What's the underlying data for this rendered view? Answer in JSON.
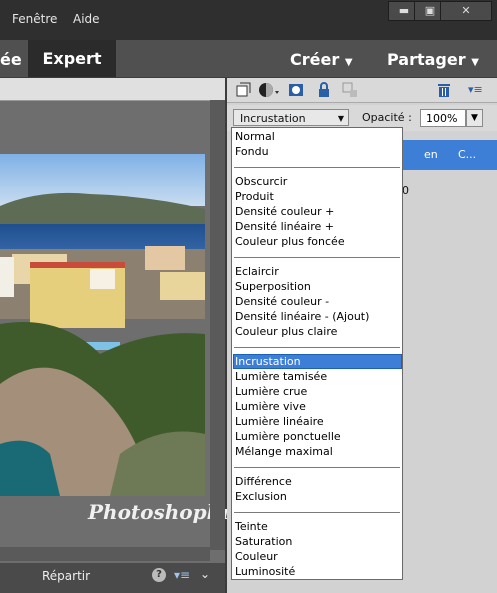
{
  "menubar": {
    "items": [
      "Fenêtre",
      "Aide"
    ]
  },
  "window_controls": {
    "minimize": "▬",
    "maximize": "▣",
    "close": "✕"
  },
  "modebar": {
    "prev_tab": "ée",
    "active_tab": "Expert",
    "create": "Créer",
    "share": "Partager",
    "arrow": "▼"
  },
  "panel": {
    "blend_selected": "Incrustation",
    "opacity_label": "Opacité :",
    "opacity_value": "100%",
    "layer_col1": "en",
    "layer_col2": "C...",
    "partial_digit": "0"
  },
  "blend_groups": [
    [
      "Normal",
      "Fondu"
    ],
    [
      "Obscurcir",
      "Produit",
      "Densité couleur +",
      "Densité linéaire +",
      "Couleur plus foncée"
    ],
    [
      "Eclaircir",
      "Superposition",
      "Densité couleur -",
      "Densité linéaire - (Ajout)",
      "Couleur plus claire"
    ],
    [
      "Incrustation",
      "Lumière tamisée",
      "Lumière crue",
      "Lumière vive",
      "Lumière linéaire",
      "Lumière ponctuelle",
      "Mélange maximal"
    ],
    [
      "Différence",
      "Exclusion"
    ],
    [
      "Teinte",
      "Saturation",
      "Couleur",
      "Luminosité"
    ]
  ],
  "bottombar": {
    "label": "Répartir"
  },
  "watermark": "Photoshoplus",
  "colors": {
    "accent": "#3d7ed6",
    "dark_bg": "#2f2f2f",
    "panel_bg": "#d2d2d2"
  }
}
